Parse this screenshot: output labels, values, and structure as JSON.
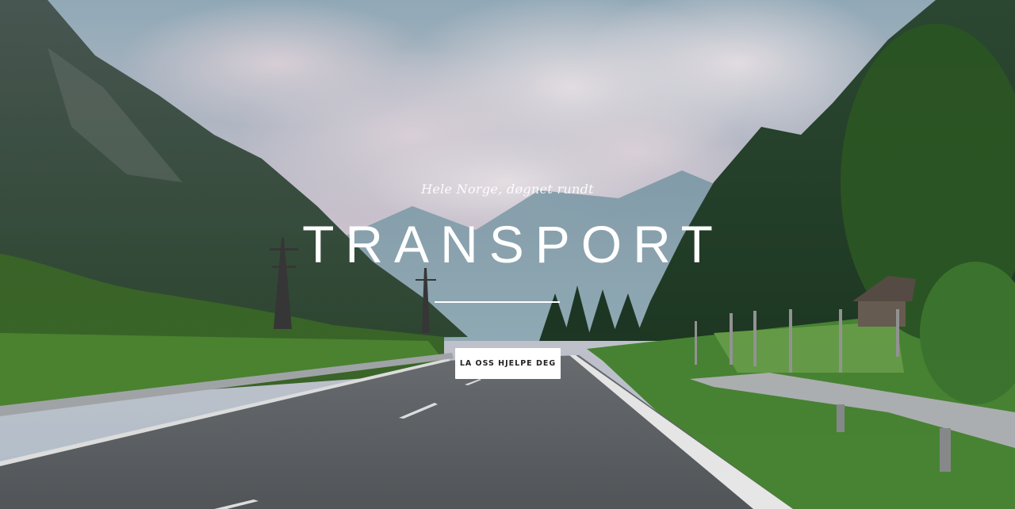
{
  "hero": {
    "tagline": "Hele Norge, døgnet rundt",
    "title": "TRANSPORT",
    "cta_label": "LA OSS HJELPE DEG",
    "background": "photo-road-through-mountain-valley"
  },
  "colors": {
    "text": "#ffffff",
    "button_bg": "#ffffff",
    "button_text": "#222222"
  }
}
